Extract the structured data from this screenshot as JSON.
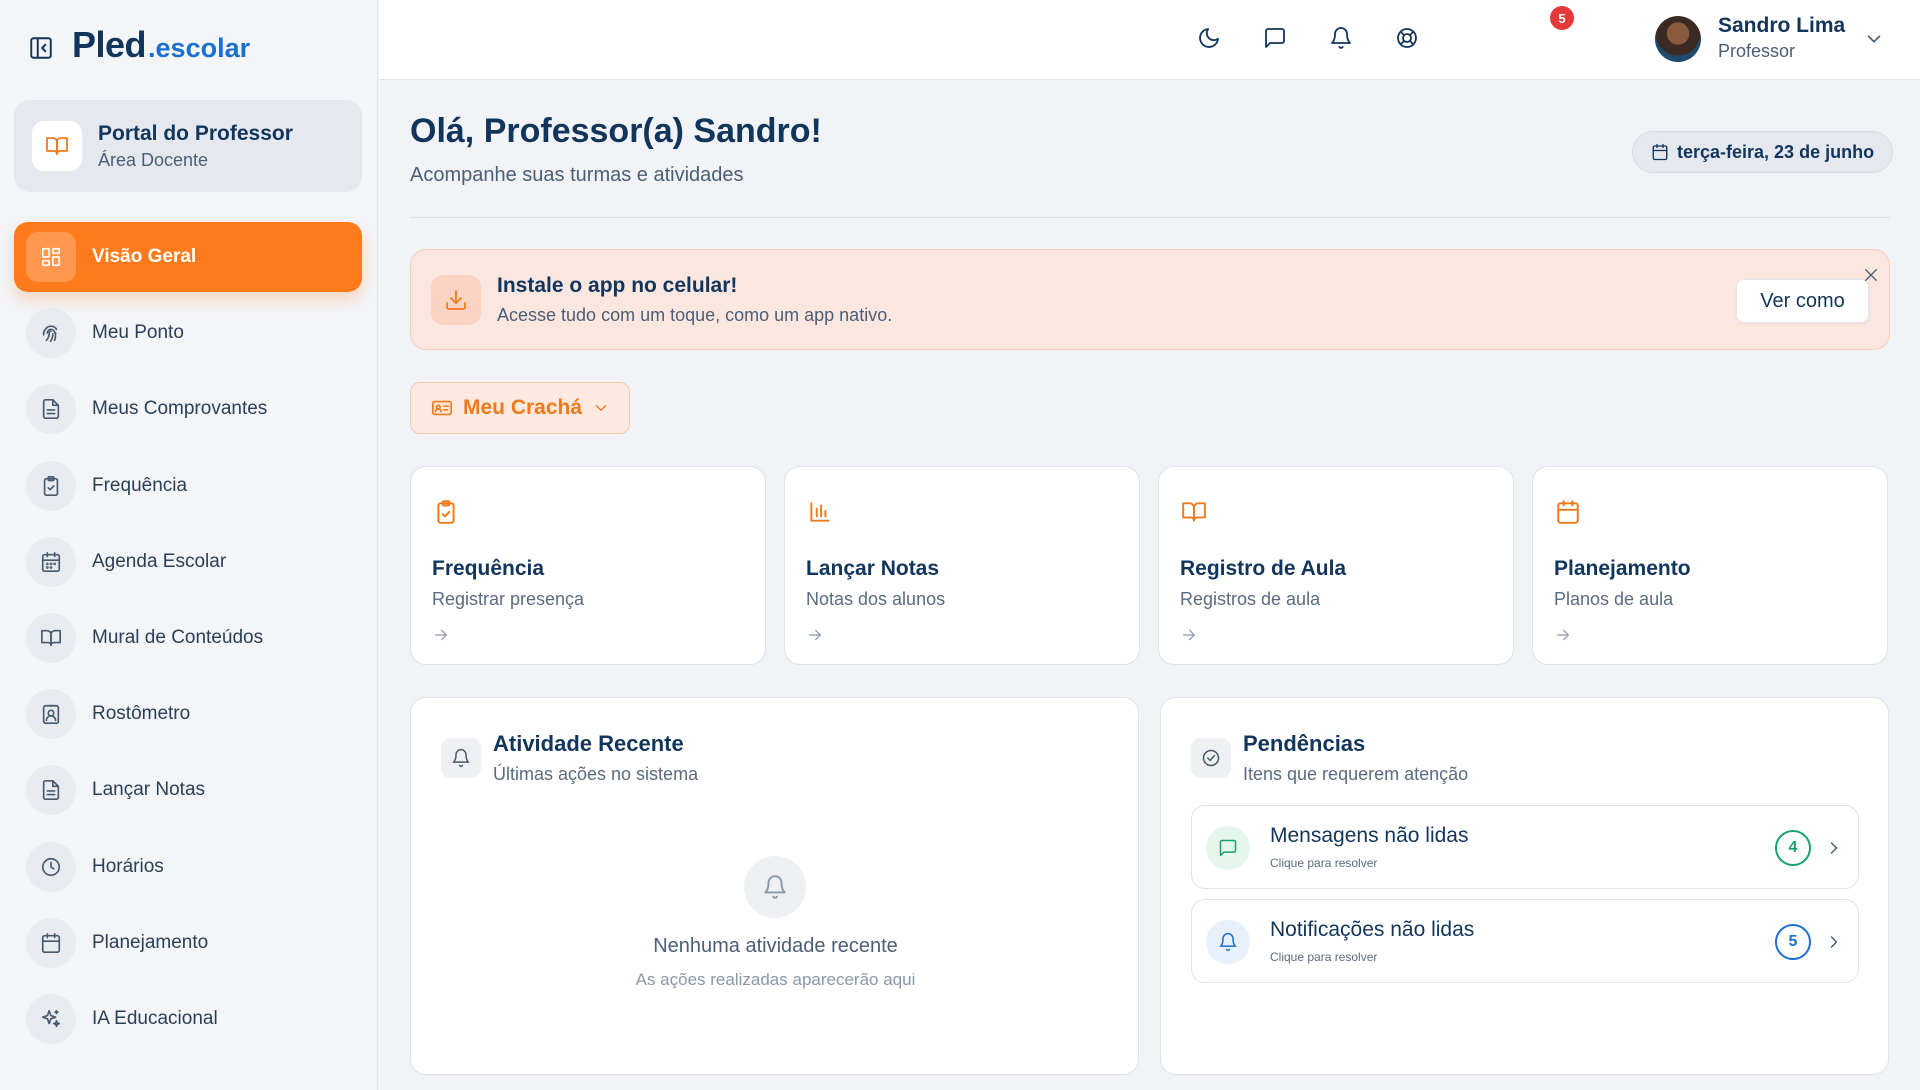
{
  "brand": {
    "logo_main": "Pled",
    "logo_sub": ".escolar"
  },
  "portal": {
    "title": "Portal do Professor",
    "subtitle": "Área Docente"
  },
  "sidebar": {
    "items": [
      {
        "label": "Visão Geral",
        "icon": "grid-icon",
        "active": true
      },
      {
        "label": "Meu Ponto",
        "icon": "fingerprint-icon"
      },
      {
        "label": "Meus Comprovantes",
        "icon": "file-text-icon"
      },
      {
        "label": "Frequência",
        "icon": "clipboard-check-icon"
      },
      {
        "label": "Agenda Escolar",
        "icon": "calendar-days-icon"
      },
      {
        "label": "Mural de Conteúdos",
        "icon": "book-open-icon"
      },
      {
        "label": "Rostômetro",
        "icon": "user-badge-icon"
      },
      {
        "label": "Lançar Notas",
        "icon": "file-text-icon"
      },
      {
        "label": "Horários",
        "icon": "clock-icon"
      },
      {
        "label": "Planejamento",
        "icon": "calendar-icon"
      },
      {
        "label": "IA Educacional",
        "icon": "sparkles-icon"
      }
    ]
  },
  "header": {
    "notification_count": "5",
    "user": {
      "name": "Sandro Lima",
      "role": "Professor"
    }
  },
  "main": {
    "greeting": "Olá, Professor(a) Sandro!",
    "subtitle": "Acompanhe suas turmas e atividades",
    "date": "terça-feira, 23 de junho"
  },
  "install_banner": {
    "title": "Instale o app no celular!",
    "subtitle": "Acesse tudo com um toque, como um app nativo.",
    "button": "Ver como"
  },
  "badge_button": {
    "label": "Meu Crachá"
  },
  "quick_cards": [
    {
      "title": "Frequência",
      "subtitle": "Registrar presença",
      "icon": "clipboard-check-icon"
    },
    {
      "title": "Lançar Notas",
      "subtitle": "Notas dos alunos",
      "icon": "bar-chart-icon"
    },
    {
      "title": "Registro de Aula",
      "subtitle": "Registros de aula",
      "icon": "book-open-icon"
    },
    {
      "title": "Planejamento",
      "subtitle": "Planos de aula",
      "icon": "calendar-icon"
    }
  ],
  "recent_activity": {
    "title": "Atividade Recente",
    "subtitle": "Últimas ações no sistema",
    "empty_title": "Nenhuma atividade recente",
    "empty_subtitle": "As ações realizadas aparecerão aqui"
  },
  "pending": {
    "title": "Pendências",
    "subtitle": "Itens que requerem atenção",
    "items": [
      {
        "title": "Mensagens não lidas",
        "subtitle": "Clique para resolver",
        "count": "4",
        "color": "#16a36a",
        "bg": "#e4f6ee"
      },
      {
        "title": "Notificações não lidas",
        "subtitle": "Clique para resolver",
        "count": "5",
        "color": "#1a6fd1",
        "bg": "#e7f0fb"
      }
    ]
  }
}
